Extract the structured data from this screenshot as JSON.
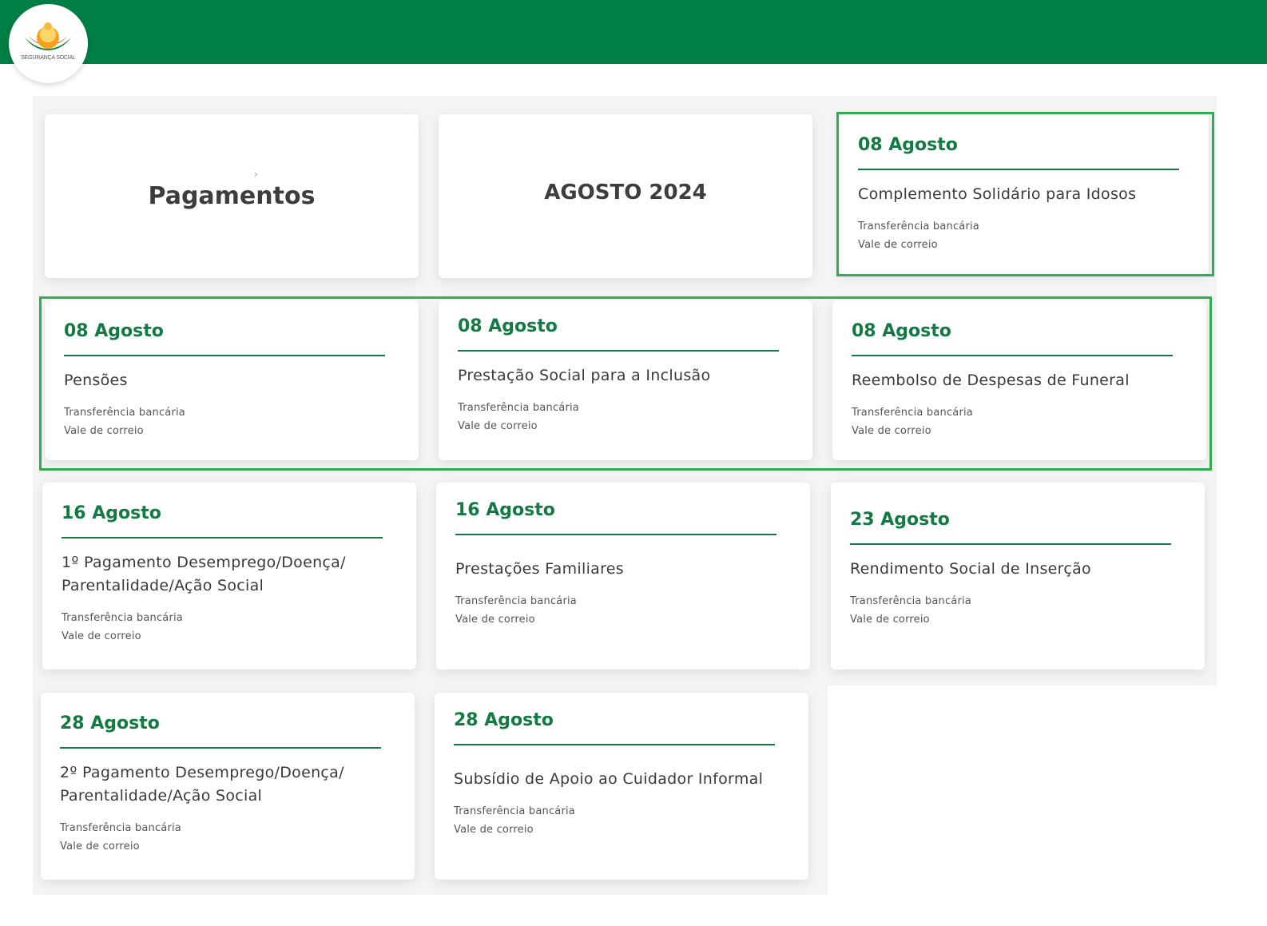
{
  "header": {
    "logo_text": "SEGURANÇA SOCIAL",
    "brand_color": "#007f45"
  },
  "title_cards": {
    "section_title": "Pagamentos",
    "month_title": "AGOSTO 2024"
  },
  "payments": [
    {
      "date": "08 Agosto",
      "benefit": "Complemento Solidário para Idosos",
      "methods": [
        "Transferência bancária",
        "Vale de correio"
      ]
    },
    {
      "date": "08 Agosto",
      "benefit": "Pensões",
      "methods": [
        "Transferência bancária",
        "Vale de correio"
      ]
    },
    {
      "date": "08 Agosto",
      "benefit": "Prestação Social para a Inclusão",
      "methods": [
        "Transferência bancária",
        "Vale de correio"
      ]
    },
    {
      "date": "08 Agosto",
      "benefit": "Reembolso de Despesas de Funeral",
      "methods": [
        "Transferência bancária",
        "Vale de correio"
      ]
    },
    {
      "date": "16 Agosto",
      "benefit": "1º Pagamento Desemprego/Doença/ Parentalidade/Ação Social",
      "methods": [
        "Transferência bancária",
        "Vale de correio"
      ]
    },
    {
      "date": "16 Agosto",
      "benefit": "Prestações Familiares",
      "methods": [
        "Transferência bancária",
        "Vale de correio"
      ]
    },
    {
      "date": "23 Agosto",
      "benefit": "Rendimento Social de Inserção",
      "methods": [
        "Transferência bancária",
        "Vale de correio"
      ]
    },
    {
      "date": "28 Agosto",
      "benefit": "2º Pagamento Desemprego/Doença/ Parentalidade/Ação Social",
      "methods": [
        "Transferência bancária",
        "Vale de correio"
      ]
    },
    {
      "date": "28 Agosto",
      "benefit": "Subsídio de Apoio ao Cuidador Informal",
      "methods": [
        "Transferência bancária",
        "Vale de correio"
      ]
    }
  ],
  "colors": {
    "date_green": "#137a43",
    "highlight_green": "#2dae4f"
  }
}
